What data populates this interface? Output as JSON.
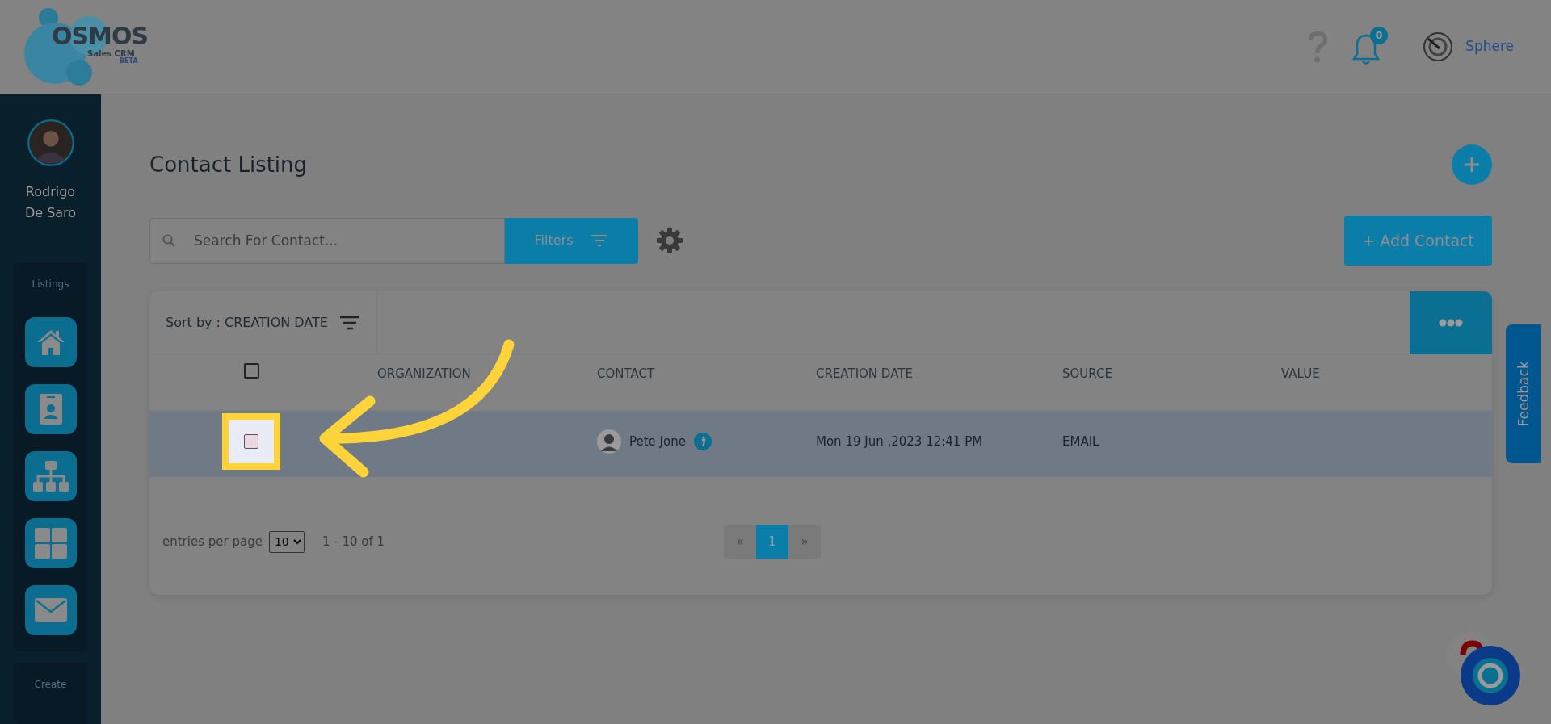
{
  "header": {
    "logo_text": "OSMOS",
    "logo_subtitle": "Sales CRM",
    "logo_badge": "BETA",
    "notification_count": "0",
    "user_name": "Sphere"
  },
  "sidebar": {
    "user_name": "Rodrigo De Saro",
    "sections": [
      {
        "title": "Listings",
        "items": [
          {
            "kind": "home"
          },
          {
            "kind": "contact"
          },
          {
            "kind": "org"
          },
          {
            "kind": "grid"
          },
          {
            "kind": "mail"
          }
        ]
      },
      {
        "title": "Create"
      }
    ]
  },
  "page": {
    "title": "Contact Listing",
    "search": {
      "placeholder": "Search For Contact..."
    },
    "filters_label": "Filters",
    "add_label": "+ Add Contact",
    "sort_label": "Sort by : ",
    "sort_value": "CREATION DATE"
  },
  "table": {
    "columns": [
      "ORGANIZATION",
      "CONTACT",
      "CREATION DATE",
      "SOURCE",
      "VALUE"
    ],
    "header_checked": false,
    "rows": [
      {
        "checked": false,
        "selected": true,
        "spotlight": true,
        "contact": "Pete Jone",
        "creation_date": "Mon 19 Jun ,2023 12:41 PM",
        "source": "EMAIL"
      }
    ]
  },
  "footer": {
    "entries_label": "entries per page",
    "page_size": "10",
    "range": "1 - 10 of 1",
    "pages": [
      {
        "label": "«",
        "selected": false
      },
      {
        "label": "1",
        "selected": true
      },
      {
        "label": "»",
        "selected": false
      }
    ]
  },
  "feedback_label": "Feedback"
}
